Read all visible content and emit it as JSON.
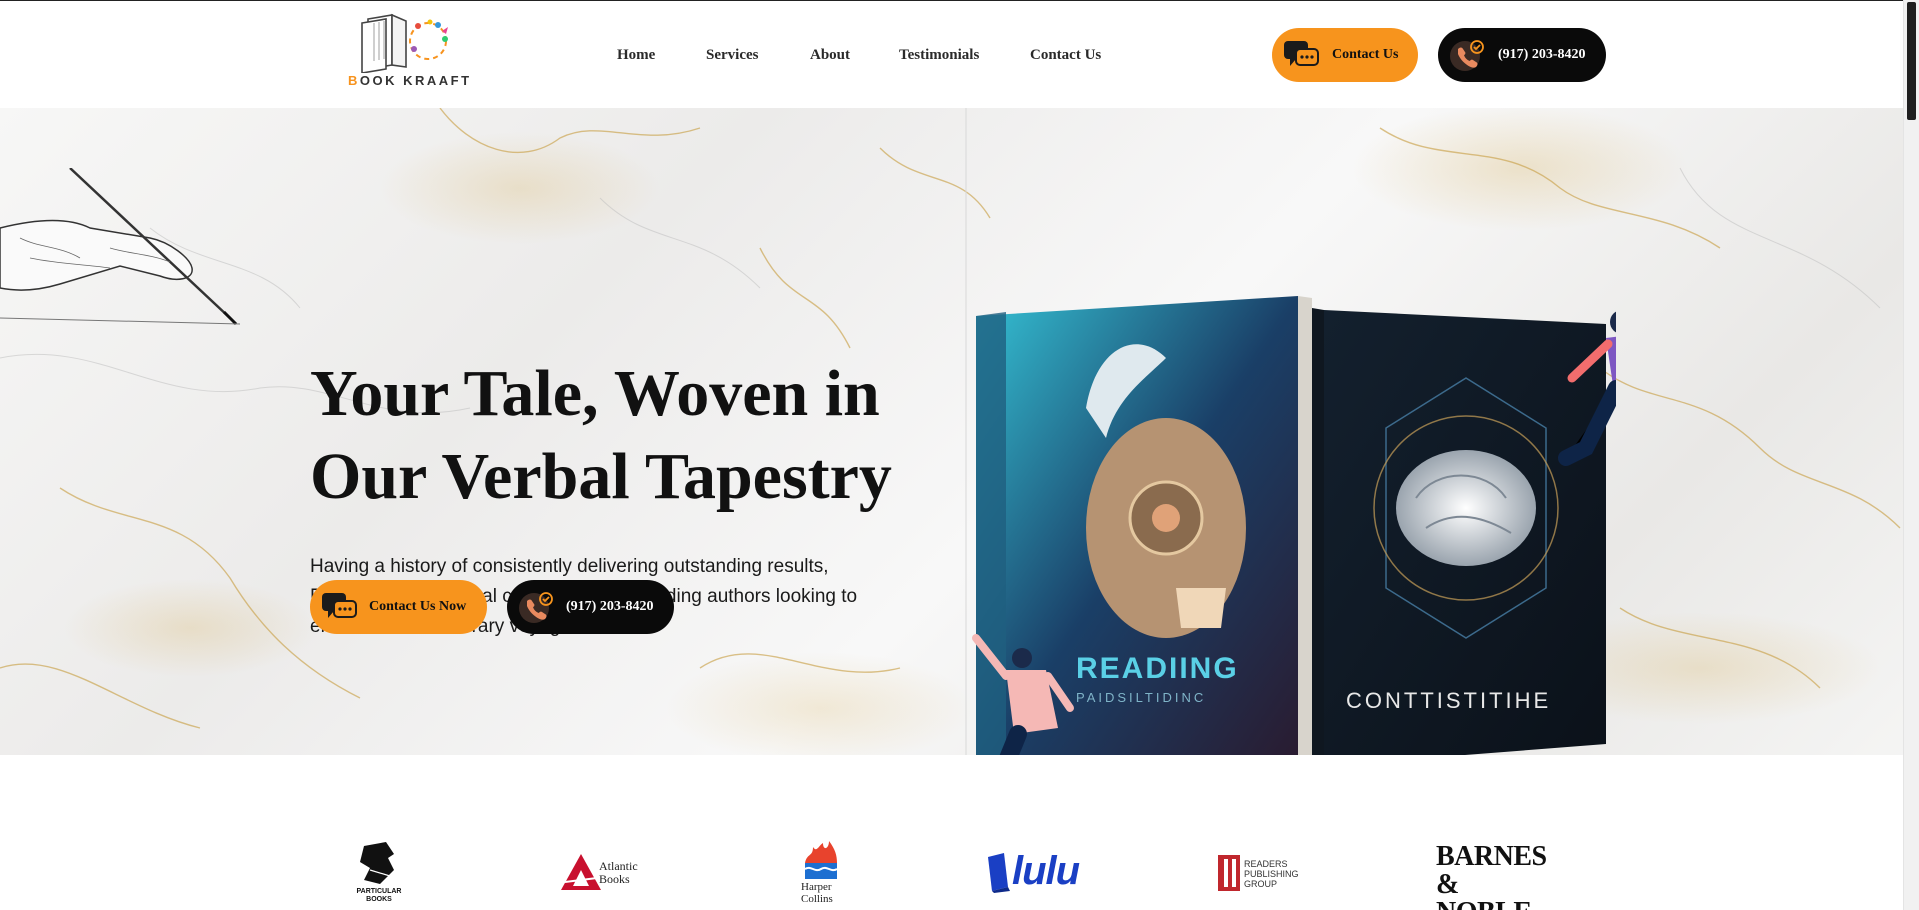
{
  "header": {
    "logo": {
      "brand_first": "B",
      "brand_rest": "OOK KRAAFT"
    },
    "nav": [
      {
        "label": "Home"
      },
      {
        "label": "Services"
      },
      {
        "label": "About"
      },
      {
        "label": "Testimonials"
      },
      {
        "label": "Contact Us"
      }
    ],
    "contact_button": {
      "label": "Contact Us",
      "icon": "chat-icon"
    },
    "phone_button": {
      "label": "(917) 203-8420",
      "icon": "phone-icon"
    }
  },
  "hero": {
    "headline_line1": "Your Tale, Woven in",
    "headline_line2": "Our Verbal Tapestry",
    "subtext": "Having a history of consistently delivering outstanding results, Bookkraaft is the ideal collaborator for budding authors looking to embark on their literary voyage.",
    "cta_primary": {
      "label": "Contact Us Now",
      "icon": "chat-icon"
    },
    "cta_phone": {
      "label": "(917) 203-8420",
      "icon": "phone-icon"
    },
    "book_left": {
      "title": "READIING",
      "subtitle": "PAIDSILTIDINC"
    },
    "book_right": {
      "title": "CONTTISTITIHE"
    }
  },
  "partners": [
    {
      "name": "PARTICULAR BOOKS"
    },
    {
      "name": "Atlantic Books"
    },
    {
      "name": "Harper Collins"
    },
    {
      "name": "lulu"
    },
    {
      "name": "READERS PUBLISHING GROUP"
    },
    {
      "name": "BARNES & NOBLE"
    }
  ],
  "colors": {
    "accent": "#f7941d",
    "dark": "#0a0a0a",
    "text": "#111111",
    "lulu_blue": "#1a3fc4",
    "harper_red": "#e8432d",
    "atlantic_red": "#c8102e"
  }
}
